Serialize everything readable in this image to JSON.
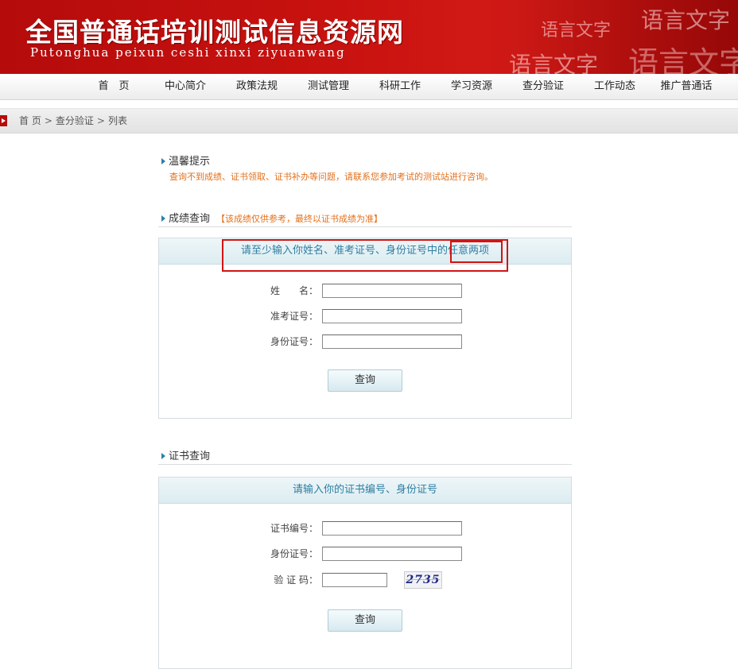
{
  "header": {
    "title": "全国普通话培训测试信息资源网",
    "subtitle": "Putonghua peixun ceshi xinxi ziyuanwang",
    "deco_text_1": "语言文字",
    "deco_text_2": "语言文字",
    "deco_text_3": "语言文字",
    "deco_text_4": "语言文字"
  },
  "nav": {
    "items": [
      {
        "label": "首　页"
      },
      {
        "label": "中心简介"
      },
      {
        "label": "政策法规"
      },
      {
        "label": "测试管理"
      },
      {
        "label": "科研工作"
      },
      {
        "label": "学习资源"
      },
      {
        "label": "查分验证"
      },
      {
        "label": "工作动态"
      },
      {
        "label": "推广普通话"
      }
    ]
  },
  "breadcrumb": {
    "home": "首 页",
    "section": "查分验证",
    "current": "列表",
    "separator": ">"
  },
  "tip": {
    "title": "温馨提示",
    "text": "查询不到成绩、证书领取、证书补办等问题，请联系您参加考试的测试站进行咨询。"
  },
  "score_query": {
    "title": "成绩查询",
    "note": "【该成绩仅供参考，最终以证书成绩为准】",
    "instruction_prefix": "请至少输入你姓名、准考证号、身份证号中的",
    "instruction_highlight": "任意两项",
    "fields": {
      "name_label": "姓　　名：",
      "exam_no_label": "准考证号：",
      "id_no_label": "身份证号："
    },
    "submit_label": "查询"
  },
  "cert_query": {
    "title": "证书查询",
    "instruction": "请输入你的证书编号、身份证号",
    "fields": {
      "cert_no_label": "证书编号：",
      "id_no_label": "身份证号：",
      "captcha_label": "验 证 码："
    },
    "captcha_value": "2735",
    "submit_label": "查询"
  },
  "colors": {
    "brand_red": "#c8120f",
    "accent_blue": "#2e7ea2",
    "tip_orange": "#e2701c",
    "highlight_red": "#d21414"
  }
}
